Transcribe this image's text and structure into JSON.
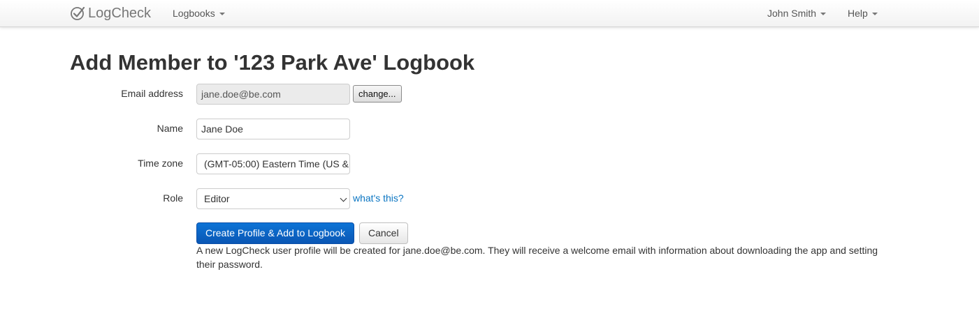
{
  "navbar": {
    "brand": "LogCheck",
    "logbooks_label": "Logbooks",
    "user_label": "John Smith",
    "help_label": "Help"
  },
  "page": {
    "title": "Add Member to '123 Park Ave' Logbook"
  },
  "form": {
    "email": {
      "label": "Email address",
      "value": "jane.doe@be.com",
      "change_label": "change..."
    },
    "name": {
      "label": "Name",
      "value": "Jane Doe"
    },
    "timezone": {
      "label": "Time zone",
      "value": "(GMT-05:00) Eastern Time (US &"
    },
    "role": {
      "label": "Role",
      "selected": "Editor",
      "whats_this": "what's this?"
    },
    "submit_label": "Create Profile & Add to Logbook",
    "cancel_label": "Cancel",
    "help_text": "A new LogCheck user profile will be created for jane.doe@be.com. They will receive a welcome email with information about downloading the app and setting their password."
  },
  "colors": {
    "link": "#0a75c2",
    "primary": "#0a62c4",
    "brand": "#777777"
  }
}
